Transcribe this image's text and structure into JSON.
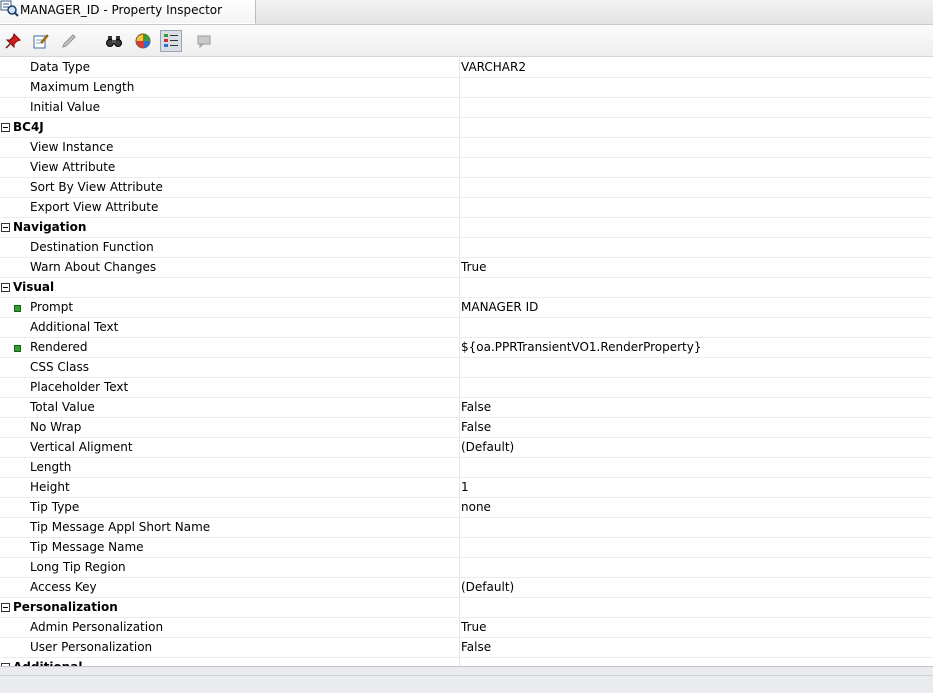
{
  "tab": {
    "title": "MANAGER_ID - Property Inspector",
    "icon": "property-inspector-icon"
  },
  "toolbar": {
    "buttons": [
      {
        "icon": "pin-icon",
        "label": "Pin"
      },
      {
        "icon": "edit-icon",
        "label": "Edit"
      },
      {
        "icon": "pencil-icon",
        "label": "Pencil"
      },
      {
        "icon": "binoculars-icon",
        "label": "Find"
      },
      {
        "icon": "color-wheel-icon",
        "label": "Color"
      },
      {
        "icon": "categorized-view-icon",
        "label": "Categorized",
        "toggled": true
      },
      {
        "icon": "comment-icon",
        "label": "Comment"
      }
    ]
  },
  "colors": {
    "marker": "#2f9e2f",
    "toggle_bg": "#d9dde4"
  },
  "rows": [
    {
      "kind": "prop",
      "name": "Data Type",
      "value": "VARCHAR2"
    },
    {
      "kind": "prop",
      "name": "Maximum Length",
      "value": ""
    },
    {
      "kind": "prop",
      "name": "Initial Value",
      "value": ""
    },
    {
      "kind": "cat",
      "name": "BC4J"
    },
    {
      "kind": "prop",
      "name": "View Instance",
      "value": ""
    },
    {
      "kind": "prop",
      "name": "View Attribute",
      "value": ""
    },
    {
      "kind": "prop",
      "name": "Sort By View Attribute",
      "value": ""
    },
    {
      "kind": "prop",
      "name": "Export View Attribute",
      "value": ""
    },
    {
      "kind": "cat",
      "name": "Navigation"
    },
    {
      "kind": "prop",
      "name": "Destination Function",
      "value": ""
    },
    {
      "kind": "prop",
      "name": "Warn About Changes",
      "value": "True"
    },
    {
      "kind": "cat",
      "name": "Visual"
    },
    {
      "kind": "prop",
      "name": "Prompt",
      "value": "MANAGER ID",
      "marked": true
    },
    {
      "kind": "prop",
      "name": "Additional Text",
      "value": ""
    },
    {
      "kind": "prop",
      "name": "Rendered",
      "value": "${oa.PPRTransientVO1.RenderProperty}",
      "marked": true
    },
    {
      "kind": "prop",
      "name": "CSS Class",
      "value": ""
    },
    {
      "kind": "prop",
      "name": "Placeholder Text",
      "value": ""
    },
    {
      "kind": "prop",
      "name": "Total Value",
      "value": "False"
    },
    {
      "kind": "prop",
      "name": "No Wrap",
      "value": "False"
    },
    {
      "kind": "prop",
      "name": "Vertical Aligment",
      "value": "(Default)"
    },
    {
      "kind": "prop",
      "name": "Length",
      "value": ""
    },
    {
      "kind": "prop",
      "name": "Height",
      "value": "1"
    },
    {
      "kind": "prop",
      "name": "Tip Type",
      "value": "none"
    },
    {
      "kind": "prop",
      "name": "Tip Message Appl Short Name",
      "value": ""
    },
    {
      "kind": "prop",
      "name": "Tip Message Name",
      "value": ""
    },
    {
      "kind": "prop",
      "name": "Long Tip Region",
      "value": ""
    },
    {
      "kind": "prop",
      "name": "Access Key",
      "value": "(Default)"
    },
    {
      "kind": "cat",
      "name": "Personalization"
    },
    {
      "kind": "prop",
      "name": "Admin Personalization",
      "value": "True"
    },
    {
      "kind": "prop",
      "name": "User Personalization",
      "value": "False"
    },
    {
      "kind": "cat",
      "name": "Additional"
    }
  ]
}
